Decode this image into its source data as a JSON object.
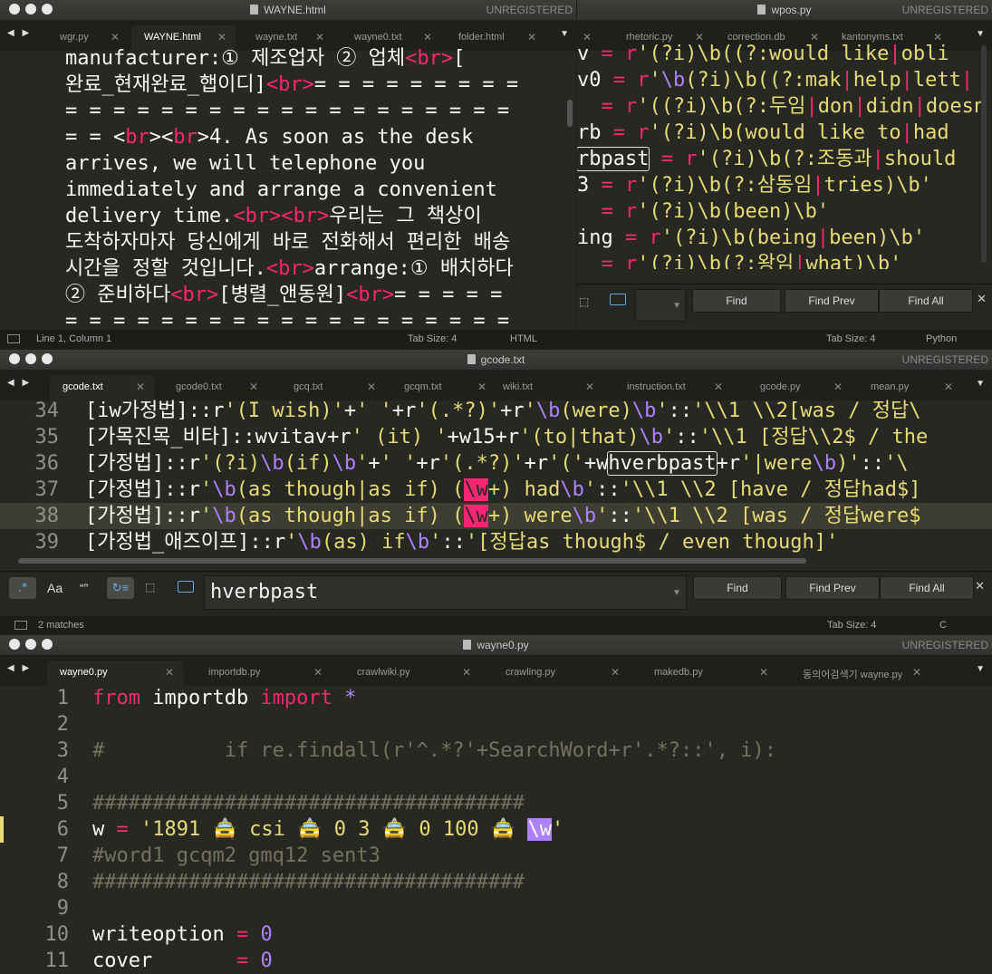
{
  "win1": {
    "title": "WAYNE.html",
    "unregistered": "UNREGISTERED",
    "tabs": [
      "wgr.py",
      "WAYNE.html",
      "wayne.txt",
      "wayne0.txt",
      "folder.html"
    ],
    "status_left": "Line 1, Column 1",
    "status_tab": "Tab Size: 4",
    "status_syntax": "HTML"
  },
  "win2": {
    "title": "wpos.py",
    "unregistered": "UNREGISTERED",
    "tabs": [
      "rhetoric.py",
      "correction.db",
      "kantonyms.txt"
    ],
    "find_btn": "Find",
    "find_prev_btn": "Find Prev",
    "find_all_btn": "Find All",
    "status_tab": "Tab Size: 4",
    "status_syntax": "Python"
  },
  "win3": {
    "title": "gcode.txt",
    "unregistered": "UNREGISTERED",
    "tabs": [
      "gcode.txt",
      "gcode0.txt",
      "gcq.txt",
      "gcqm.txt",
      "wiki.txt",
      "instruction.txt",
      "gcode.py",
      "mean.py"
    ],
    "line_numbers": [
      "34",
      "35",
      "36",
      "37",
      "38",
      "39"
    ],
    "find_query": "hverbpast",
    "find_btn": "Find",
    "find_prev_btn": "Find Prev",
    "find_all_btn": "Find All",
    "regex_icon_label": ".*",
    "case_icon_label": "Aa",
    "word_icon_label": "“”",
    "status_left": "2 matches",
    "status_tab": "Tab Size: 4",
    "status_syntax": "C"
  },
  "win4": {
    "title": "wayne0.py",
    "unregistered": "UNREGISTERED",
    "tabs": [
      "wayne0.py",
      "importdb.py",
      "crawlwiki.py",
      "crawling.py",
      "makedb.py",
      "동의어검색기 wayne.py"
    ],
    "line_numbers": [
      "1",
      "2",
      "3",
      "4",
      "5",
      "6",
      "7",
      "8",
      "9",
      "10",
      "11"
    ]
  }
}
